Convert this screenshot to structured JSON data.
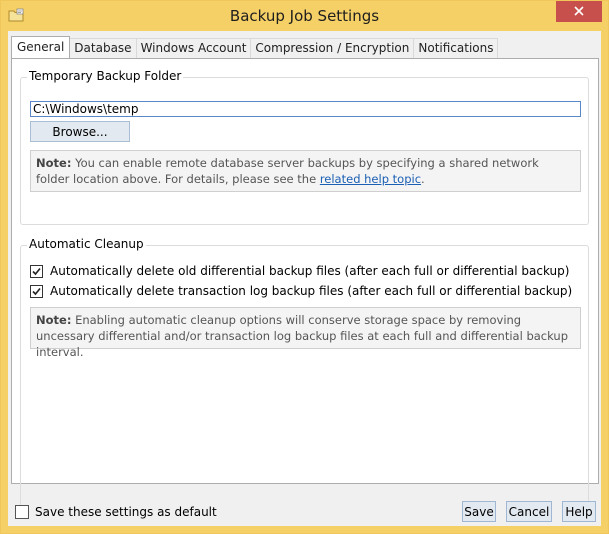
{
  "window": {
    "title": "Backup Job Settings"
  },
  "tabs": [
    {
      "label": "General",
      "active": true
    },
    {
      "label": "Database",
      "active": false
    },
    {
      "label": "Windows Account",
      "active": false
    },
    {
      "label": "Compression / Encryption",
      "active": false
    },
    {
      "label": "Notifications",
      "active": false
    }
  ],
  "temp_folder": {
    "group_title": "Temporary Backup Folder",
    "path_value": "C:\\Windows\\temp",
    "browse_label": "Browse...",
    "note_prefix": "Note:",
    "note_text": " You can enable remote database server backups by specifying a shared network folder location above. For details, please see the ",
    "note_link": "related help topic",
    "note_suffix": "."
  },
  "cleanup": {
    "group_title": "Automatic Cleanup",
    "options": [
      {
        "label": "Automatically delete old differential backup files (after each full or differential backup)",
        "checked": true
      },
      {
        "label": "Automatically delete transaction log backup files (after each full or differential backup)",
        "checked": true
      }
    ],
    "note_prefix": "Note:",
    "note_text": " Enabling automatic cleanup options will conserve storage space by removing uncessary differential and/or transaction log backup files at each full and differential backup interval."
  },
  "footer": {
    "save_default_label": "Save these settings as default",
    "save_default_checked": false,
    "save_label": "Save",
    "cancel_label": "Cancel",
    "help_label": "Help"
  },
  "colors": {
    "title_bar": "#f5d067",
    "close_button": "#c7504c",
    "link": "#1a5fb4"
  }
}
